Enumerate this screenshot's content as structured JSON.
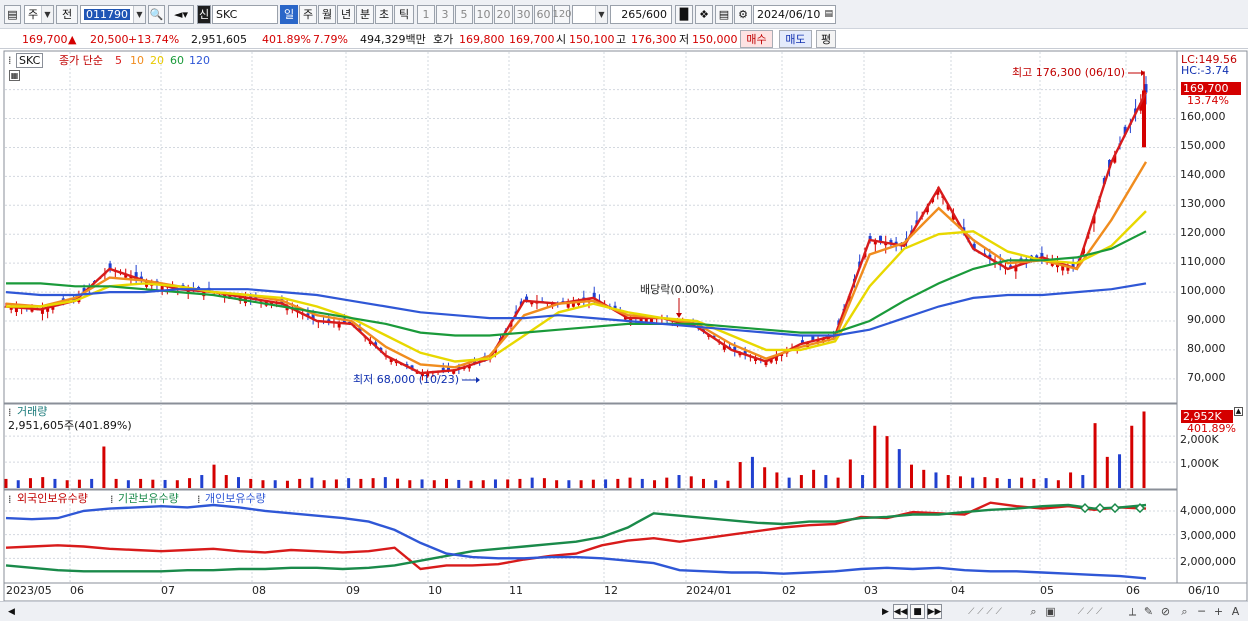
{
  "toolbar": {
    "period_unit": "주",
    "prev_label": "전",
    "code": "011790",
    "new_badge": "신",
    "stock_name": "SKC",
    "periods": [
      "일",
      "주",
      "월",
      "년",
      "분",
      "초",
      "틱"
    ],
    "active_period": "일",
    "minute_steps": [
      "1",
      "3",
      "5",
      "10",
      "20",
      "30",
      "60",
      "120"
    ],
    "count_value": "265",
    "count_max": "/600",
    "date_value": "2024/06/10"
  },
  "quote": {
    "price": "169,700",
    "change_arrow": "▲",
    "change": "20,500",
    "change_pct": "+13.74%",
    "volume": "2,951,605",
    "volume_ratio": "401.89%",
    "turnover": "7.79%",
    "amount": "494,329백만",
    "bid_ask_label": "호가",
    "ask": "169,800",
    "bid": "169,700",
    "open_label": "시",
    "open": "150,100",
    "high_label": "고",
    "high": "176,300",
    "low_label": "저",
    "low": "150,000",
    "buy_button": "매수",
    "sell_button": "매도",
    "eval_button": "평"
  },
  "legend": {
    "name": "SKC",
    "series_label": "종가 단순",
    "ma": [
      {
        "label": "5",
        "color": "#d81b1b"
      },
      {
        "label": "10",
        "color": "#f08c1e"
      },
      {
        "label": "20",
        "color": "#e8d800"
      },
      {
        "label": "60",
        "color": "#1a9a3a"
      },
      {
        "label": "120",
        "color": "#2f57d6"
      }
    ]
  },
  "price_panel": {
    "lc": "LC:149.56",
    "hc": "HC:-3.74",
    "last_price": "169,700",
    "last_pct": "13.74%",
    "high_note": "최고 176,300 (06/10)",
    "low_note": "최저 68,000 (10/23)",
    "dividend_note": "배당락(0.00%)",
    "ylim": [
      62000,
      183000
    ],
    "yticks": [
      "160,000",
      "150,000",
      "140,000",
      "130,000",
      "120,000",
      "110,000",
      "100,000",
      "90,000",
      "80,000",
      "70,000"
    ]
  },
  "volume_panel": {
    "title": "거래량",
    "value": "2,951,605주(401.89%)",
    "badge_value": "2,952K",
    "badge_pct": "401.89%",
    "yticks": [
      "2,000K",
      "1,000K"
    ]
  },
  "holdings_panel": {
    "series": [
      {
        "name": "외국인보유수량",
        "color": "#d81b1b"
      },
      {
        "name": "기관보유수량",
        "color": "#1a8a4a"
      },
      {
        "name": "개인보유수량",
        "color": "#2f57d6"
      }
    ],
    "yticks": [
      "4,000,000",
      "3,000,000",
      "2,000,000"
    ]
  },
  "x_axis": {
    "labels": [
      "2023/05",
      "06",
      "07",
      "08",
      "09",
      "10",
      "11",
      "12",
      "2024/01",
      "02",
      "03",
      "04",
      "05",
      "06"
    ],
    "right_label": "06/10"
  },
  "colors": {
    "up": "#d40000",
    "down": "#2040d0",
    "grid": "#c9cfd8"
  },
  "chart_data": [
    {
      "type": "line",
      "title": "SKC",
      "series": [
        {
          "name": "5",
          "values": [
            95000,
            94000,
            97000,
            108000,
            104000,
            101000,
            100000,
            98000,
            96000,
            90000,
            89000,
            78000,
            72000,
            73000,
            77000,
            97000,
            96000,
            98000,
            91000,
            91000,
            88000,
            80000,
            76000,
            82000,
            85000,
            118000,
            116000,
            136000,
            115000,
            108000,
            112000,
            108000,
            145000,
            169000
          ]
        },
        {
          "name": "10",
          "values": [
            96000,
            95000,
            98000,
            105000,
            104000,
            102000,
            100000,
            99000,
            97000,
            92000,
            90000,
            81000,
            75000,
            74000,
            78000,
            92000,
            96000,
            97000,
            92000,
            91000,
            89000,
            82000,
            77000,
            81000,
            84000,
            113000,
            117000,
            129000,
            118000,
            110000,
            111000,
            108000,
            125000,
            145000
          ]
        },
        {
          "name": "20",
          "values": [
            95000,
            95000,
            97000,
            102000,
            103000,
            102000,
            100000,
            99000,
            98000,
            95000,
            91000,
            85000,
            79000,
            76000,
            77000,
            85000,
            93000,
            96000,
            93000,
            91000,
            90000,
            85000,
            80000,
            80000,
            83000,
            102000,
            115000,
            120000,
            121000,
            114000,
            111000,
            110000,
            116000,
            128000
          ]
        },
        {
          "name": "60",
          "values": [
            103000,
            103000,
            102000,
            102000,
            101000,
            100000,
            99000,
            97000,
            95000,
            93000,
            91000,
            89000,
            86000,
            85000,
            85000,
            86000,
            87000,
            88000,
            89000,
            89000,
            89000,
            88000,
            87000,
            86000,
            86000,
            90000,
            97000,
            103000,
            108000,
            111000,
            111000,
            112000,
            115000,
            121000
          ]
        },
        {
          "name": "120",
          "values": [
            100000,
            99000,
            99000,
            100000,
            100000,
            101000,
            101000,
            101000,
            100000,
            99000,
            97000,
            95000,
            93000,
            92000,
            91000,
            91000,
            92000,
            91000,
            90000,
            89000,
            88000,
            87000,
            86000,
            85000,
            85000,
            87000,
            91000,
            95000,
            98000,
            99000,
            99000,
            100000,
            101000,
            103000
          ]
        }
      ],
      "ylim": [
        62000,
        183000
      ]
    },
    {
      "type": "bar",
      "title": "거래량",
      "ylabel": "거래량",
      "series": [
        {
          "name": "거래량",
          "values": [
            350,
            300,
            380,
            420,
            350,
            300,
            320,
            350,
            1600,
            350,
            300,
            350,
            320,
            310,
            300,
            380,
            500,
            900,
            500,
            420,
            350,
            300,
            300,
            280,
            350,
            400,
            300,
            330,
            380,
            350,
            380,
            420,
            360,
            300,
            330,
            300,
            350,
            310,
            280,
            300,
            330,
            330,
            350,
            400,
            380,
            300,
            300,
            300,
            320,
            330,
            350,
            400,
            350,
            300,
            400,
            500,
            450,
            350,
            300,
            280,
            1000,
            1200,
            800,
            600,
            400,
            500,
            700,
            500,
            400,
            1100,
            500,
            2400,
            2000,
            1500,
            900,
            700,
            600,
            500,
            450,
            400,
            420,
            380,
            350,
            400,
            350,
            380,
            300,
            600,
            500,
            2500,
            1200,
            1300,
            2400,
            2950
          ]
        }
      ],
      "ylim": [
        0,
        3200000
      ]
    },
    {
      "type": "line",
      "title": "보유수량",
      "series": [
        {
          "name": "외국인보유수량",
          "values": [
            2450000,
            2500000,
            2550000,
            2500000,
            2400000,
            2350000,
            2300000,
            2350000,
            2400000,
            2300000,
            2250000,
            2350000,
            2300000,
            2250000,
            2300000,
            2450000,
            1550000,
            1700000,
            1700000,
            1750000,
            1950000,
            2100000,
            2200000,
            2550000,
            2750000,
            2850000,
            2700000,
            2850000,
            3000000,
            3150000,
            3300000,
            3400000,
            3450000,
            3750000,
            3700000,
            3950000,
            3900000,
            3850000,
            4350000,
            4200000,
            4100000,
            4200000,
            4050000,
            4150000,
            4100000
          ]
        },
        {
          "name": "기관보유수량",
          "values": [
            1700000,
            1600000,
            1500000,
            1450000,
            1450000,
            1450000,
            1450000,
            1500000,
            1500000,
            1550000,
            1550000,
            1600000,
            1600000,
            1550000,
            1600000,
            1700000,
            1900000,
            2100000,
            2300000,
            2400000,
            2500000,
            2600000,
            2700000,
            2900000,
            3300000,
            3900000,
            3800000,
            3700000,
            3600000,
            3500000,
            3450000,
            3550000,
            3550000,
            3700000,
            3750000,
            3850000,
            3850000,
            3950000,
            4050000,
            4100000,
            4200000,
            4250000,
            4100000,
            4150000,
            4250000
          ]
        },
        {
          "name": "개인보유수량",
          "values": [
            3700000,
            3650000,
            3700000,
            4000000,
            4100000,
            4150000,
            4200000,
            4150000,
            4250000,
            4150000,
            4000000,
            3900000,
            3800000,
            3700000,
            3550000,
            3200000,
            2650000,
            2200000,
            2050000,
            2000000,
            2000000,
            2050000,
            2050000,
            2000000,
            1900000,
            1800000,
            1500000,
            1450000,
            1400000,
            1400000,
            1350000,
            1400000,
            1450000,
            1550000,
            1600000,
            1550000,
            1600000,
            1500000,
            1450000,
            1450000,
            1400000,
            1350000,
            1300000,
            1250000,
            1150000
          ]
        }
      ],
      "ylim": [
        1000000,
        4800000
      ]
    }
  ]
}
